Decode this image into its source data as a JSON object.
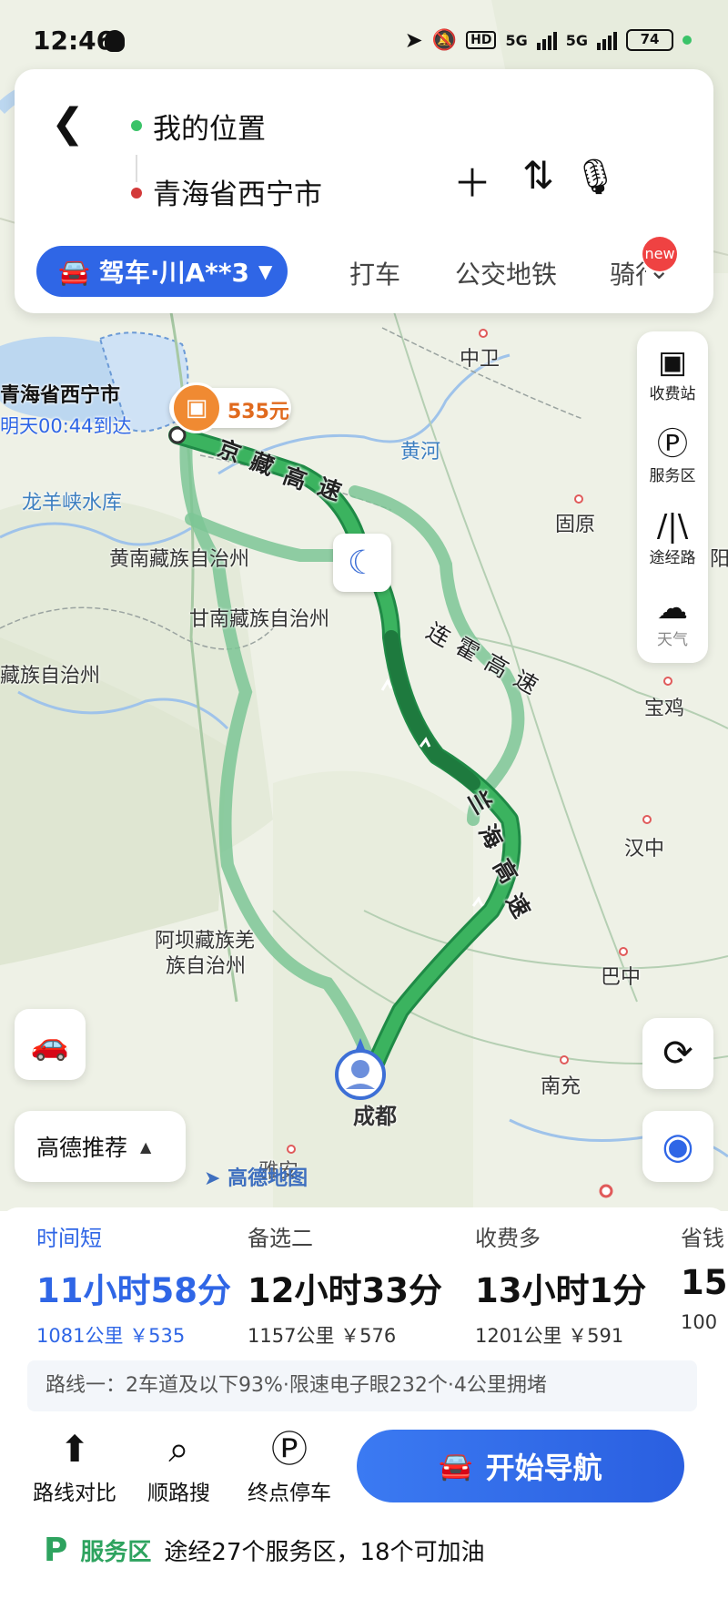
{
  "status_bar": {
    "time": "12:46",
    "network1": "5G",
    "network2": "5G",
    "hd": "HD",
    "battery": "74"
  },
  "search": {
    "origin": "我的位置",
    "destination": "青海省西宁市",
    "add_icon": "plus-icon",
    "swap_icon": "swap-icon",
    "voice_icon": "microphone-icon"
  },
  "tabs": {
    "drive": "驾车·川A**3",
    "taxi": "打车",
    "transit": "公交地铁",
    "ride": "骑行",
    "new_badge": "new"
  },
  "map": {
    "dest_label": "青海省西宁市",
    "arrive_label": "明天00:44到达",
    "toll_badge": "535元",
    "places": [
      "中卫",
      "黄河",
      "固原",
      "龙羊峡水库",
      "黄南藏族自治州",
      "甘南藏族自治州",
      "藏族自治州",
      "宝鸡",
      "汉中",
      "阿坝藏族羌",
      "族自治州",
      "巴中",
      "南充",
      "成都",
      "雅安",
      "阳"
    ],
    "highways": [
      "京",
      "藏",
      "高",
      "速",
      "连",
      "霍",
      "高",
      "速",
      "兰",
      "海",
      "高",
      "速"
    ],
    "logo": "高德地图"
  },
  "tools": [
    {
      "icon": "toll-station-icon",
      "label": "收费站"
    },
    {
      "icon": "service-area-icon",
      "label": "服务区"
    },
    {
      "icon": "route-via-icon",
      "label": "途经路"
    },
    {
      "icon": "weather-icon",
      "label": "天气"
    }
  ],
  "recommend": "高德推荐",
  "routes": [
    {
      "name": "时间短",
      "time": "11小时58分",
      "detail": "1081公里 ￥535",
      "selected": true
    },
    {
      "name": "备选二",
      "time": "12小时33分",
      "detail": "1157公里 ￥576"
    },
    {
      "name": "收费多",
      "time": "13小时1分",
      "detail": "1201公里 ￥591"
    },
    {
      "name": "省钱",
      "time": "15",
      "detail": "100"
    }
  ],
  "summary": "路线一：2车道及以下93%·限速电子眼232个·4公里拥堵",
  "bottom_actions": {
    "compare": "路线对比",
    "search_along": "顺路搜",
    "parking": "终点停车"
  },
  "start_nav": "开始导航",
  "service": {
    "title": "服务区",
    "detail": "途经27个服务区，18个可加油"
  }
}
